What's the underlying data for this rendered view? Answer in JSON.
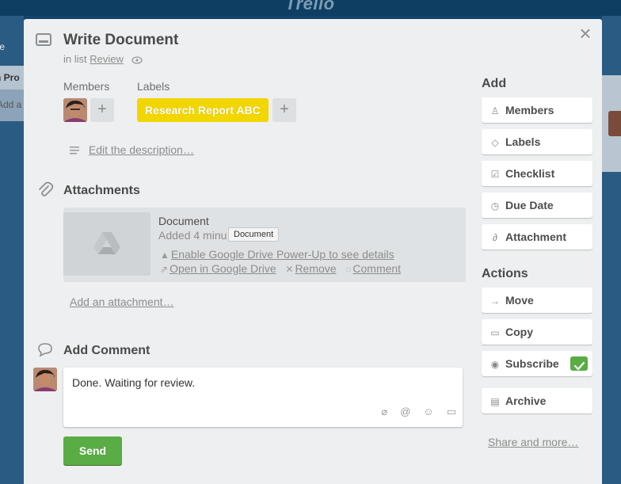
{
  "background": {
    "logo": "Trello",
    "left_fragment_1": "te",
    "left_fragment_2": "n Pro",
    "left_fragment_3": "Add a"
  },
  "card": {
    "title": "Write Document",
    "in_list_prefix": "in list",
    "list_name": "Review",
    "members_label": "Members",
    "labels_label": "Labels",
    "label_text": "Research Report ABC",
    "label_color": "#f2d600",
    "description_link": "Edit the description…"
  },
  "attachments": {
    "heading": "Attachments",
    "item": {
      "name": "Document",
      "added": "Added 4 minu",
      "tooltip": "Document",
      "gdrive_link": "Enable Google Drive Power-Up to see details",
      "open_link": "Open in Google Drive",
      "remove": "Remove",
      "comment": "Comment"
    },
    "add_link": "Add an attachment…"
  },
  "comment": {
    "heading": "Add Comment",
    "text": "Done. Waiting for review.",
    "send": "Send",
    "send_color": "#5aac44"
  },
  "sidebar": {
    "add_heading": "Add",
    "add_buttons": [
      "Members",
      "Labels",
      "Checklist",
      "Due Date",
      "Attachment"
    ],
    "actions_heading": "Actions",
    "action_buttons": [
      "Move",
      "Copy",
      "Subscribe",
      "Archive"
    ],
    "share_link": "Share and more…"
  }
}
